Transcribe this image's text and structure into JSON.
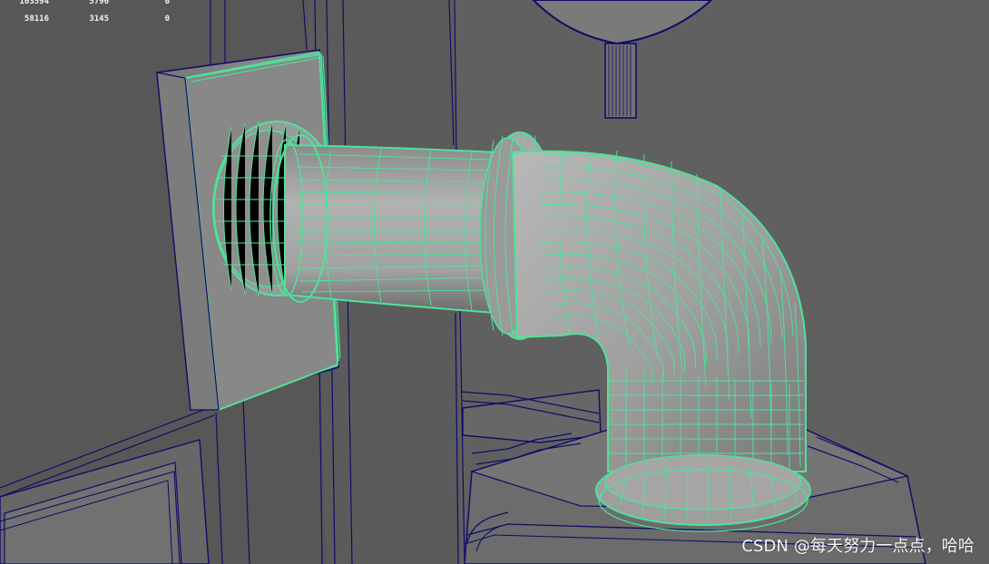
{
  "hud": {
    "row1": [
      "103594",
      "5796",
      "0"
    ],
    "row2": [
      "58116",
      "3145",
      "0"
    ]
  },
  "watermark": "CSDN @每天努力一点点，哈哈",
  "colors": {
    "background": "#5f5f5f",
    "wireframe_selected": "#4de39a",
    "wireframe_default": "#0f0d67",
    "mesh_fill_light": "#9a9a9a",
    "mesh_fill_dark": "#6f6f6f"
  }
}
